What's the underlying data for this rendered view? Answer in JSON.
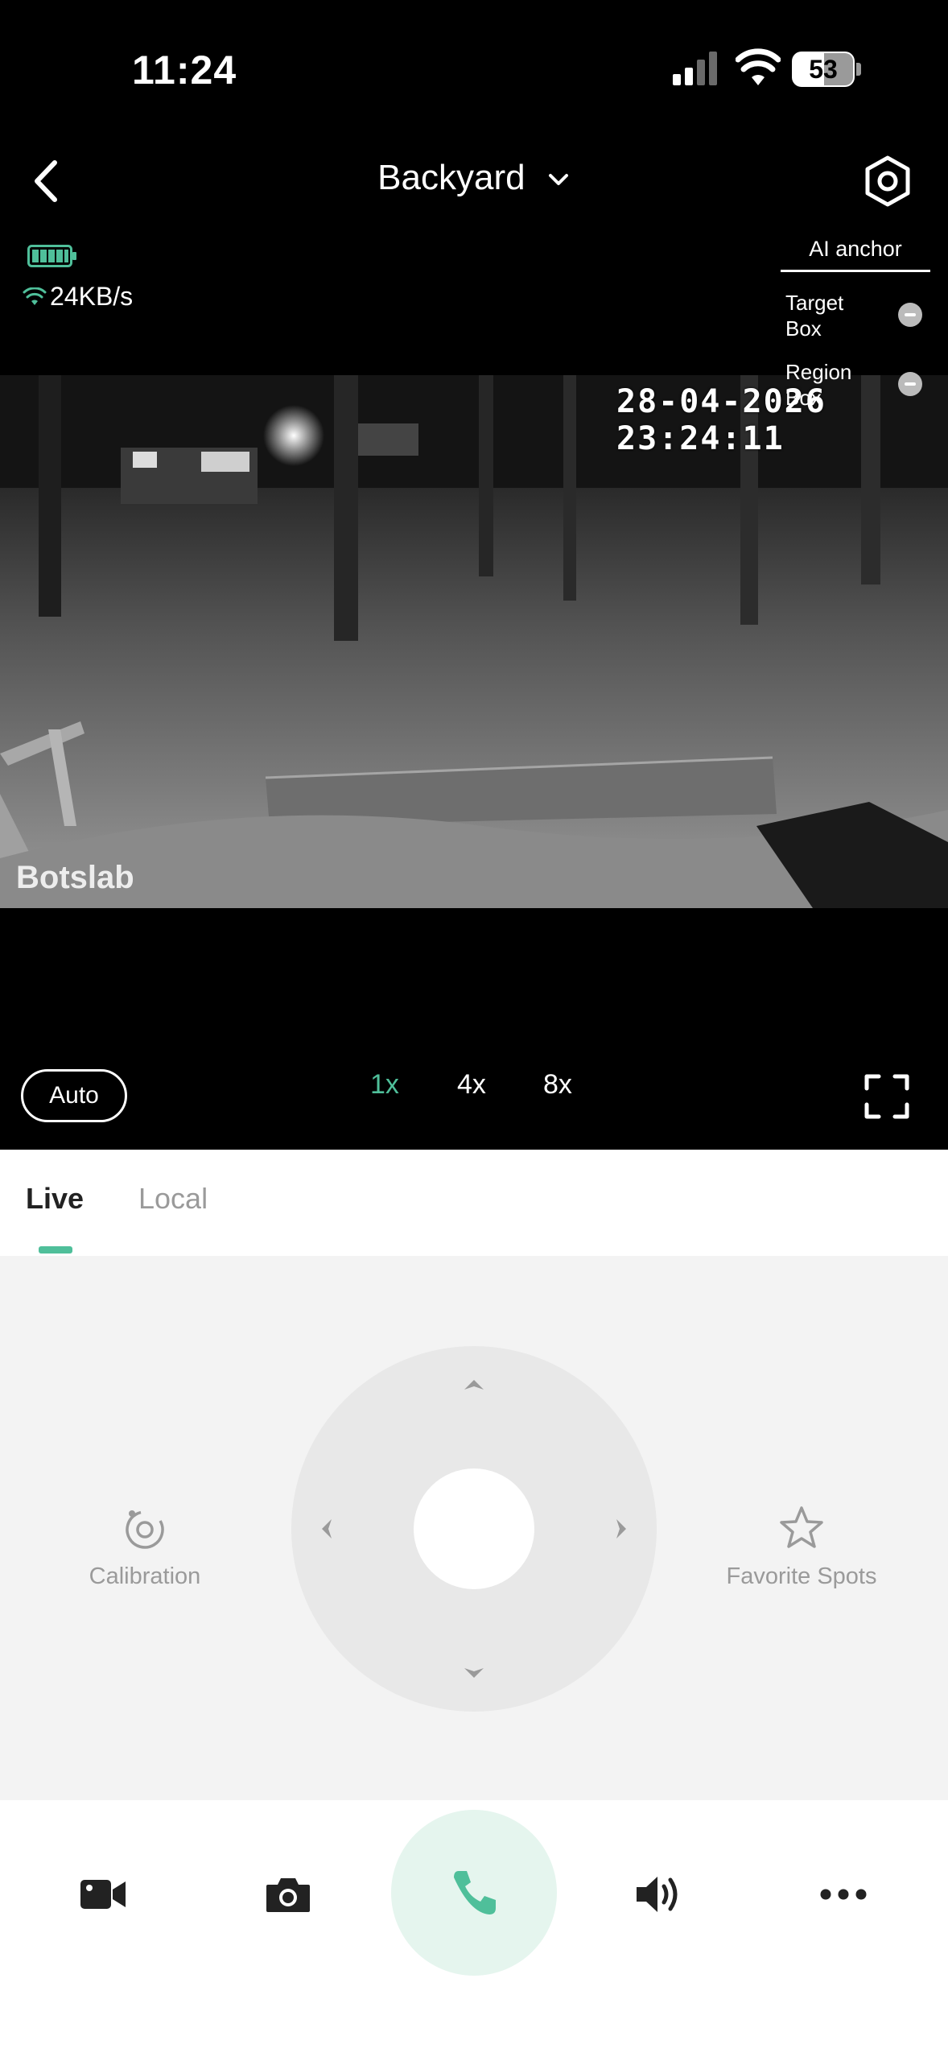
{
  "status_bar": {
    "time": "11:24",
    "battery_level": "53"
  },
  "header": {
    "title": "Backyard"
  },
  "camera_stats": {
    "speed": "24KB/s"
  },
  "ai_anchor": {
    "title": "AI anchor",
    "target_box": "Target Box",
    "region_box": "Region Box"
  },
  "video": {
    "timestamp": "28-04-2026 23:24:11",
    "watermark": "Botslab"
  },
  "controls": {
    "auto": "Auto",
    "zoom_levels": [
      "1x",
      "4x",
      "8x"
    ],
    "active_zoom": "1x"
  },
  "tabs": {
    "live": "Live",
    "local": "Local"
  },
  "panel": {
    "calibration": "Calibration",
    "favorite_spots": "Favorite Spots"
  },
  "colors": {
    "accent": "#4fbf9a",
    "call_bg": "#e5f5ee",
    "panel_bg": "#f3f3f3"
  }
}
